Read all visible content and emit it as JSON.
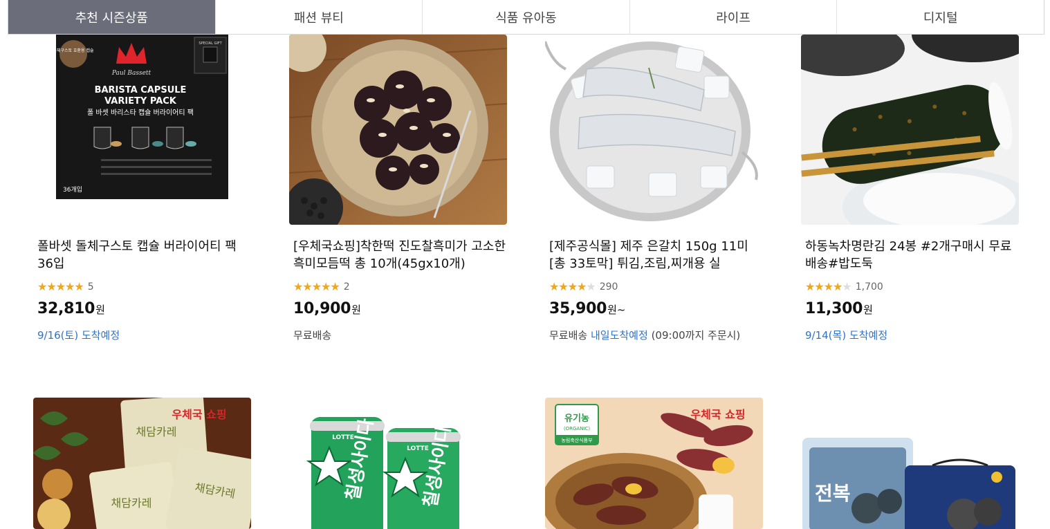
{
  "tabs": [
    {
      "label": "추천 시즌상품",
      "active": true
    },
    {
      "label": "패션 뷰티"
    },
    {
      "label": "식품 유아동"
    },
    {
      "label": "라이프"
    },
    {
      "label": "디지털"
    }
  ],
  "products": [
    {
      "title": "폴바셋 돌체구스토 캡슐 버라이어티 팩 36입",
      "rating": 5,
      "rating_count": "5",
      "price": "32,810",
      "price_unit": "원",
      "delivery": "9/16(토) 도착예정",
      "image_text": {
        "brand": "Paul Bassett",
        "line1": "BARISTA CAPSULE",
        "line2": "VARIETY PACK",
        "kr": "폴 바셋 바리스타 캡슐 버라이어티 팩",
        "badge": "돌체구스토 호환용 캡슐",
        "gift": "SPECIAL GIFT",
        "count": "36개입"
      }
    },
    {
      "title": "[우체국쇼핑]착한떡 진도찰흑미가 고소한 흑미모듬떡 총 10개(45gx10개)",
      "rating": 5,
      "rating_count": "2",
      "price": "10,900",
      "price_unit": "원",
      "shipping": "무료배송"
    },
    {
      "title": "[제주공식몰] 제주 은갈치 150g 11미 [총 33토막] 튀김,조림,찌개용 실",
      "rating": 4,
      "rating_count": "290",
      "price": "35,900",
      "price_unit": "원~",
      "shipping": "무료배송",
      "delivery": "내일도착예정",
      "delivery_note": "(09:00까지 주문시)"
    },
    {
      "title": "하동녹차명란김 24봉 #2개구매시 무료배송#밥도둑",
      "rating": 4,
      "rating_count": "1,700",
      "price": "11,300",
      "price_unit": "원",
      "delivery": "9/14(목) 도착예정"
    },
    {
      "image_text": {
        "logo": "우체국 쇼핑",
        "name": "채담카레"
      }
    },
    {
      "image_text": {
        "brand": "LOTTE",
        "name": "칠성사이다"
      }
    },
    {
      "image_text": {
        "logo": "우체국 쇼핑",
        "badge": "유기농",
        "badge_en": "(ORGANIC)",
        "badge_sub": "농림축산식품부"
      }
    },
    {
      "image_text": {
        "name": "전복"
      }
    }
  ],
  "colors": {
    "tab_active": "#6b6e7a",
    "star": "#f2a717",
    "link_blue": "#2f73c8"
  }
}
